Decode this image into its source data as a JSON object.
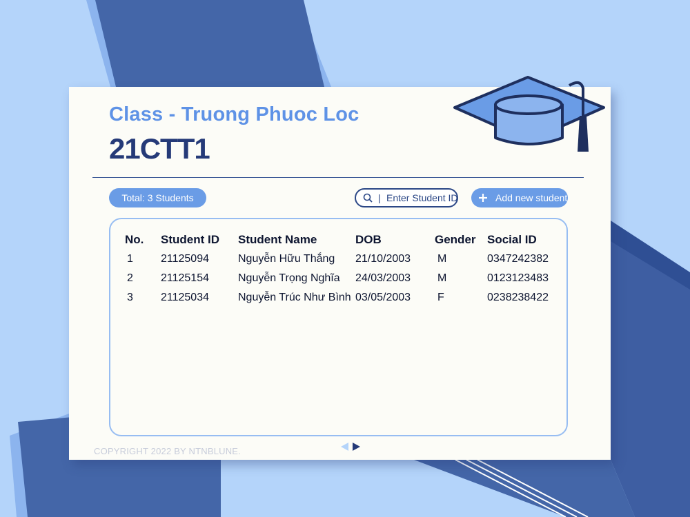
{
  "header": {
    "class_title": "Class - Truong Phuoc Loc",
    "class_code": "21CTT1"
  },
  "toolbar": {
    "total_label": "Total: 3 Students",
    "search_placeholder": "Enter Student ID",
    "search_separator": "|",
    "add_label": "Add new student"
  },
  "table": {
    "headers": [
      "No.",
      "Student ID",
      "Student Name",
      "DOB",
      "Gender",
      "Social ID"
    ],
    "rows": [
      [
        "1",
        "21125094",
        "Nguyễn Hữu Thắng",
        "21/10/2003",
        "M",
        "0347242382"
      ],
      [
        "2",
        "21125154",
        "Nguyễn Trọng Nghĩa",
        "24/03/2003",
        "M",
        "0123123483"
      ],
      [
        "3",
        "21125034",
        "Nguyễn Trúc Như Bình",
        "03/05/2003",
        "F",
        "0238238422"
      ]
    ]
  },
  "footer": {
    "copyright": "COPYRIGHT 2022 BY NTNBLUNE."
  },
  "colors": {
    "background": "#b4d4fa",
    "card": "#fcfcf7",
    "accent": "#6a9ce6",
    "navy": "#253a78"
  },
  "icons": [
    "graduation-cap-icon",
    "search-icon",
    "plus-icon",
    "chevron-left-icon",
    "chevron-right-icon"
  ]
}
